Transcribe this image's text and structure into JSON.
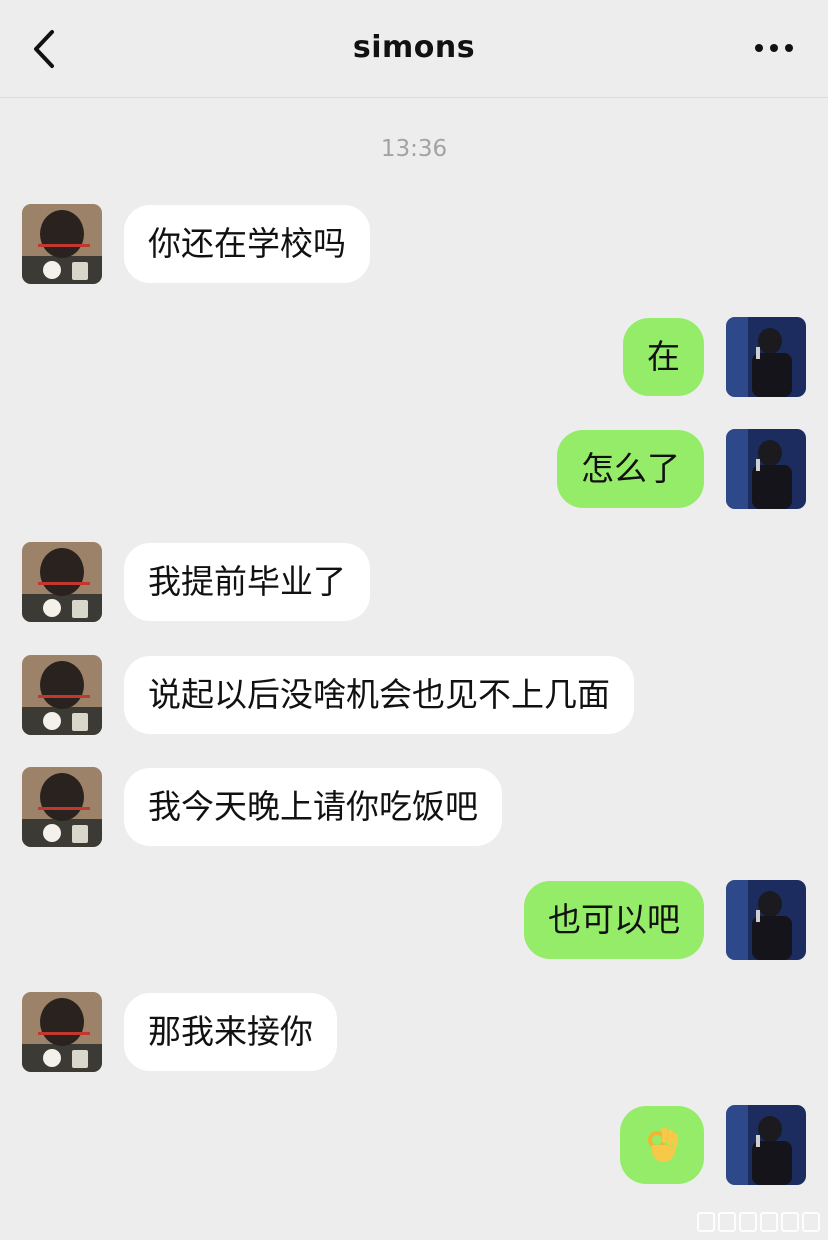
{
  "header": {
    "title": "simons"
  },
  "timestamp": "13:36",
  "messages": [
    {
      "side": "friend",
      "text": "你还在学校吗"
    },
    {
      "side": "me",
      "text": "在"
    },
    {
      "side": "me",
      "text": "怎么了"
    },
    {
      "side": "friend",
      "text": "我提前毕业了"
    },
    {
      "side": "friend",
      "text": "说起以后没啥机会也见不上几面"
    },
    {
      "side": "friend",
      "text": "我今天晚上请你吃饭吧"
    },
    {
      "side": "me",
      "text": "也可以吧"
    },
    {
      "side": "friend",
      "text": "那我来接你"
    },
    {
      "side": "me",
      "text": "",
      "emoji": "ok-hand"
    }
  ],
  "colors": {
    "background": "#ededed",
    "sent_bubble": "#95ec69",
    "received_bubble": "#ffffff",
    "timestamp": "#a3a3a3"
  }
}
